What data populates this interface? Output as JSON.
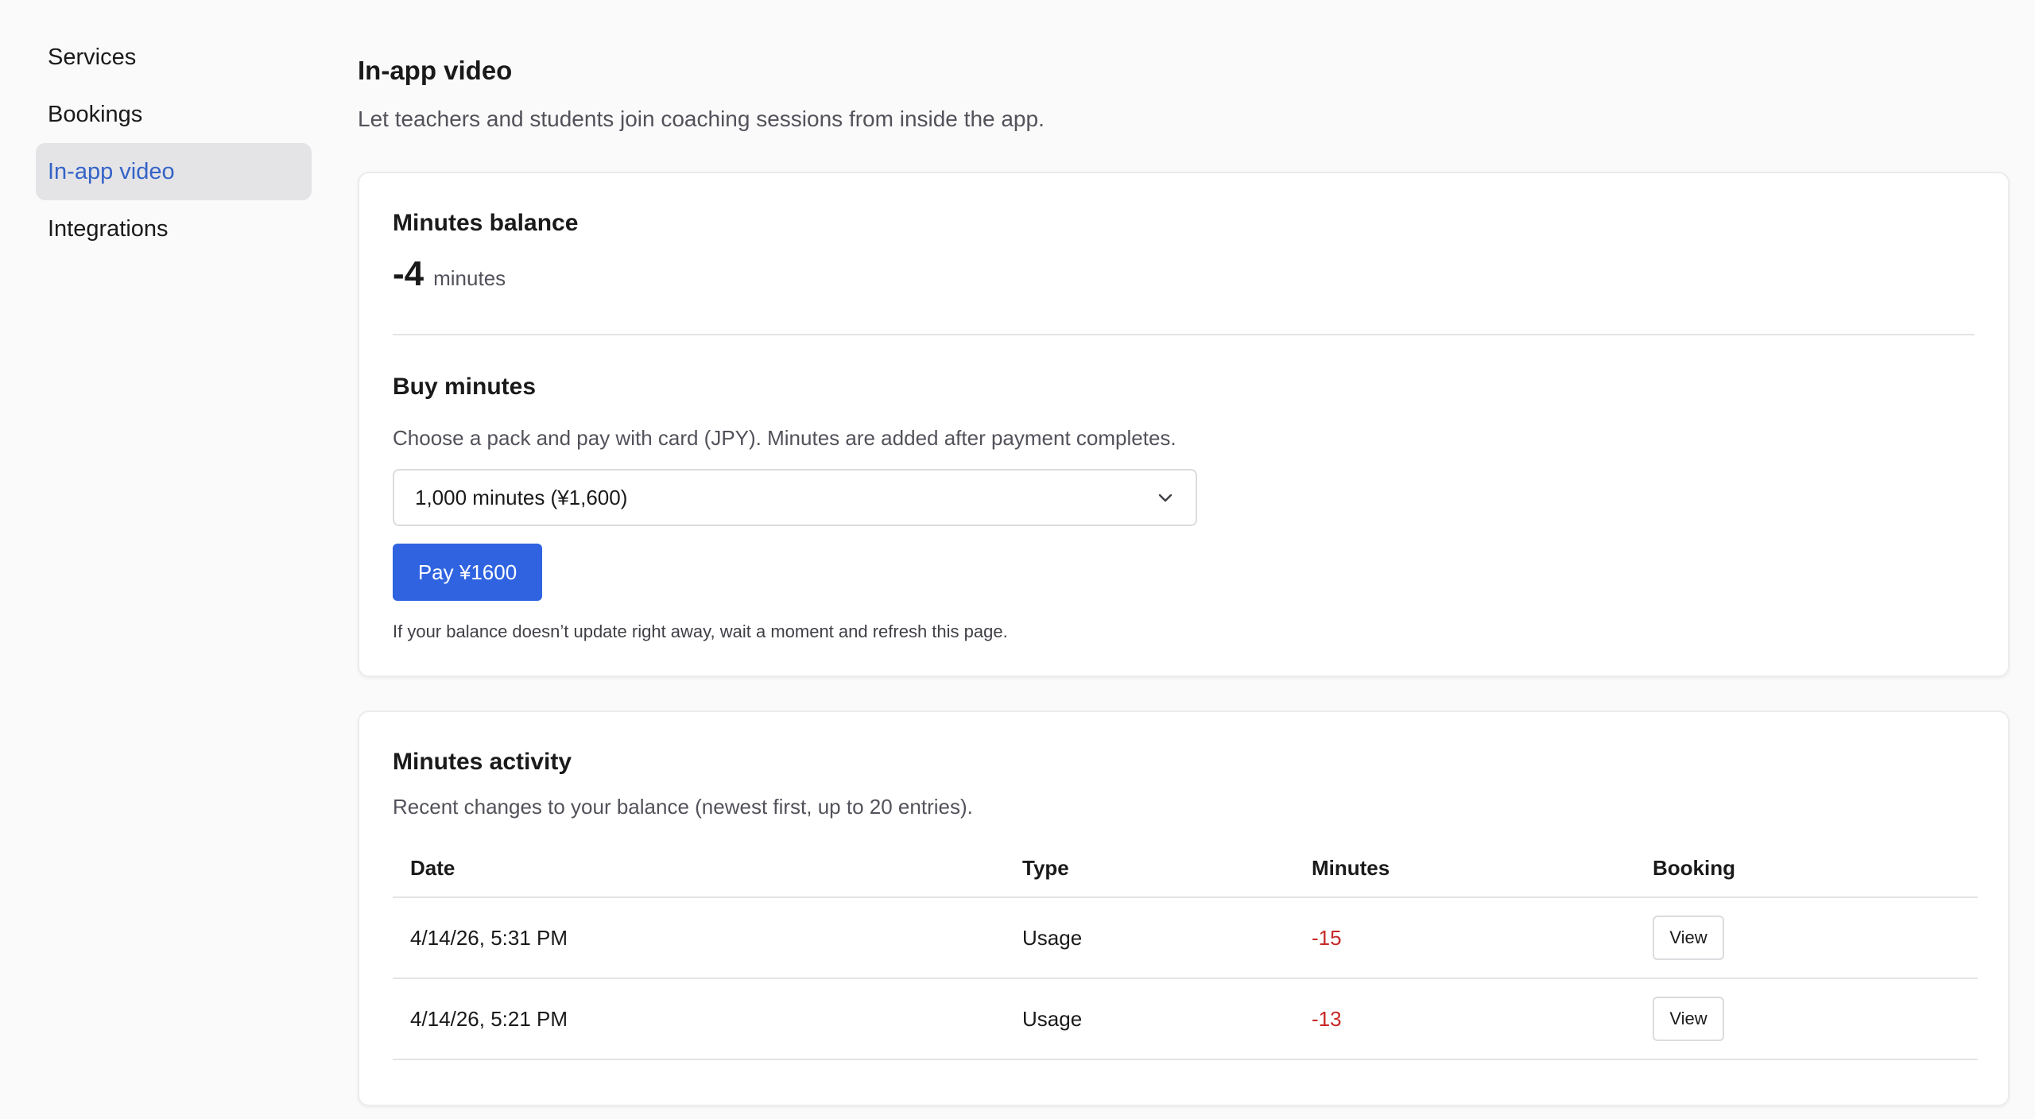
{
  "sidebar": {
    "items": [
      {
        "label": "Services",
        "active": false
      },
      {
        "label": "Bookings",
        "active": false
      },
      {
        "label": "In-app video",
        "active": true
      },
      {
        "label": "Integrations",
        "active": false
      }
    ]
  },
  "header": {
    "title": "In-app video",
    "subtitle": "Let teachers and students join coaching sessions from inside the app."
  },
  "balance_card": {
    "balance_title": "Minutes balance",
    "balance_value": "-4",
    "balance_unit": "minutes",
    "buy_title": "Buy minutes",
    "buy_description": "Choose a pack and pay with card (JPY). Minutes are added after payment completes.",
    "pack_select": {
      "selected": "1,000 minutes (¥1,600)"
    },
    "pay_button_label": "Pay ¥1600",
    "note": "If your balance doesn’t update right away, wait a moment and refresh this page."
  },
  "activity_card": {
    "title": "Minutes activity",
    "description": "Recent changes to your balance (newest first, up to 20 entries).",
    "columns": [
      "Date",
      "Type",
      "Minutes",
      "Booking"
    ],
    "rows": [
      {
        "date": "4/14/26, 5:31 PM",
        "type": "Usage",
        "minutes": "-15",
        "booking": "View"
      },
      {
        "date": "4/14/26, 5:21 PM",
        "type": "Usage",
        "minutes": "-13",
        "booking": "View"
      }
    ]
  },
  "colors": {
    "accent": "#2f63e0",
    "active_nav_text": "#3563c7",
    "active_nav_bg": "#e4e4e7",
    "negative": "#c62828"
  }
}
